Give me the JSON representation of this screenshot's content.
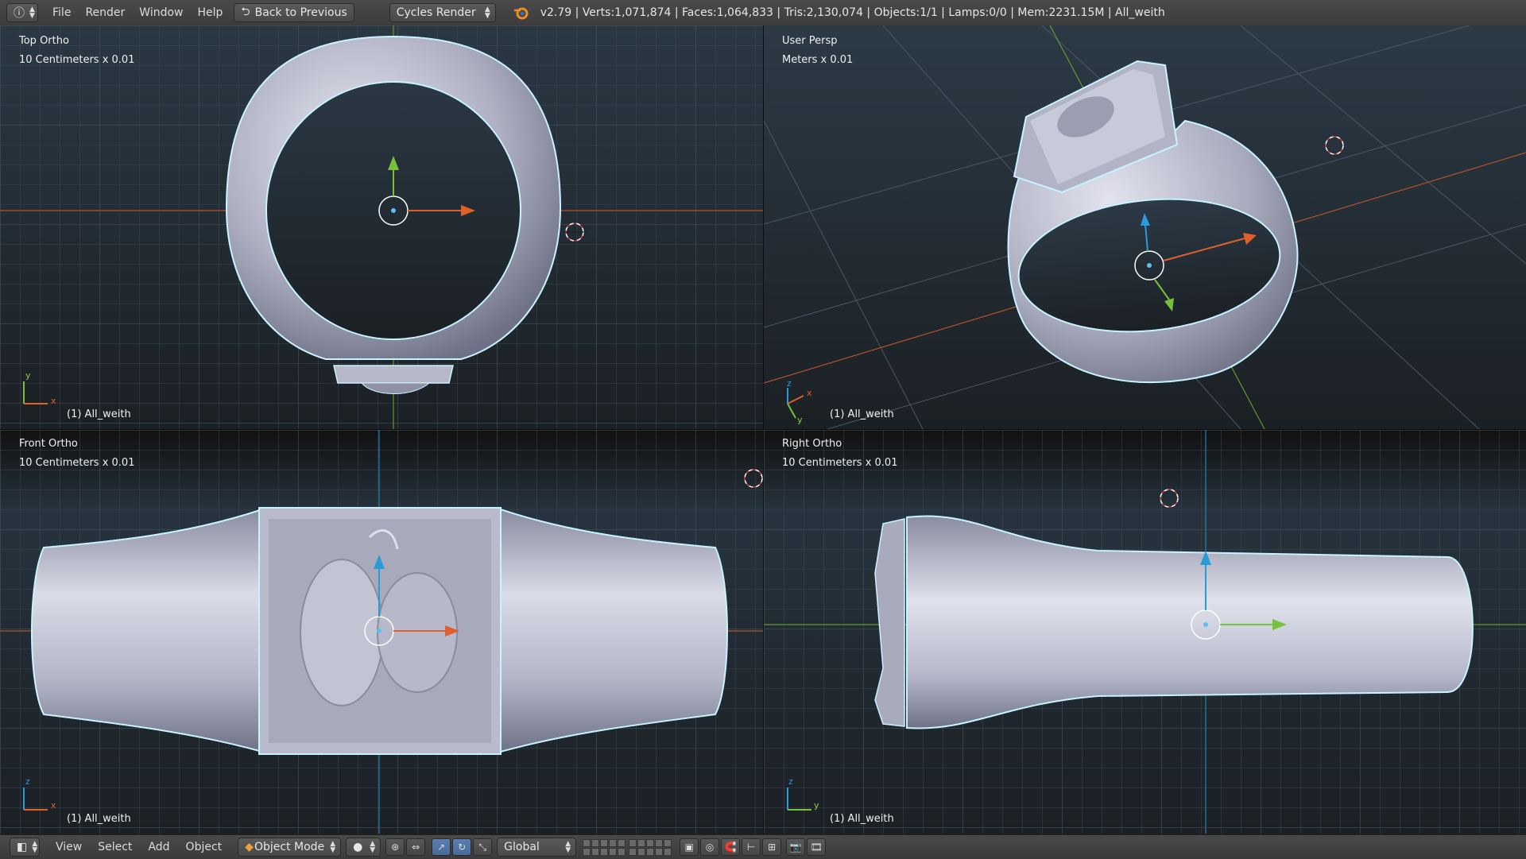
{
  "header": {
    "editor_icon": "info-icon",
    "menus": [
      "File",
      "Render",
      "Window",
      "Help"
    ],
    "back_button": "Back to Previous",
    "engine": "Cycles Render",
    "stats": "v2.79 | Verts:1,071,874 | Faces:1,064,833 | Tris:2,130,074 | Objects:1/1 | Lamps:0/0 | Mem:2231.15M | All_weith"
  },
  "viewports": {
    "top_left": {
      "view": "Top Ortho",
      "scale": "10 Centimeters x 0.01",
      "object": "(1) All_weith",
      "axis_a": "y",
      "axis_b": "x"
    },
    "top_right": {
      "view": "User Persp",
      "scale": "Meters x 0.01",
      "object": "(1) All_weith",
      "axis_a": "z",
      "axis_b": "x",
      "axis_c": "y"
    },
    "bottom_left": {
      "view": "Front Ortho",
      "scale": "10 Centimeters x 0.01",
      "object": "(1) All_weith",
      "axis_a": "z",
      "axis_b": "x"
    },
    "bottom_right": {
      "view": "Right Ortho",
      "scale": "10 Centimeters x 0.01",
      "object": "(1) All_weith",
      "axis_a": "z",
      "axis_b": "y"
    }
  },
  "footer": {
    "menus": [
      "View",
      "Select",
      "Add",
      "Object"
    ],
    "mode": "Object Mode",
    "orientation": "Global"
  },
  "colors": {
    "x_axis": "#c8542a",
    "y_axis": "#6ea532",
    "z_axis": "#2a9bd6",
    "selection_outline": "#c9f2ff"
  }
}
